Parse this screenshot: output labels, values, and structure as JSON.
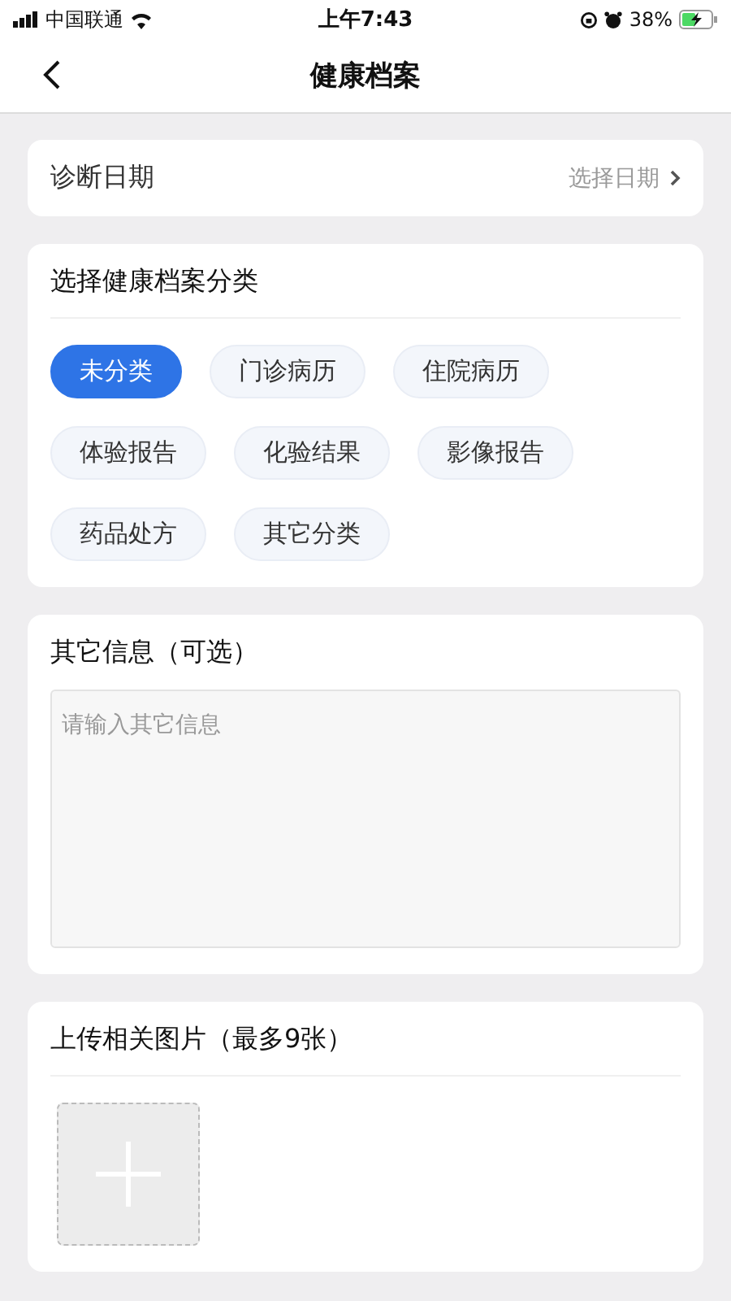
{
  "status_bar": {
    "carrier": "中国联通",
    "time": "上午7:43",
    "battery": "38%"
  },
  "nav": {
    "title": "健康档案"
  },
  "date_row": {
    "label": "诊断日期",
    "value": "选择日期"
  },
  "category_card": {
    "title": "选择健康档案分类",
    "chips": [
      {
        "label": "未分类",
        "selected": true
      },
      {
        "label": "门诊病历",
        "selected": false
      },
      {
        "label": "住院病历",
        "selected": false
      },
      {
        "label": "体验报告",
        "selected": false
      },
      {
        "label": "化验结果",
        "selected": false
      },
      {
        "label": "影像报告",
        "selected": false
      },
      {
        "label": "药品处方",
        "selected": false
      },
      {
        "label": "其它分类",
        "selected": false
      }
    ]
  },
  "info_card": {
    "title": "其它信息（可选）",
    "placeholder": "请输入其它信息"
  },
  "upload_card": {
    "title": "上传相关图片（最多9张）"
  }
}
